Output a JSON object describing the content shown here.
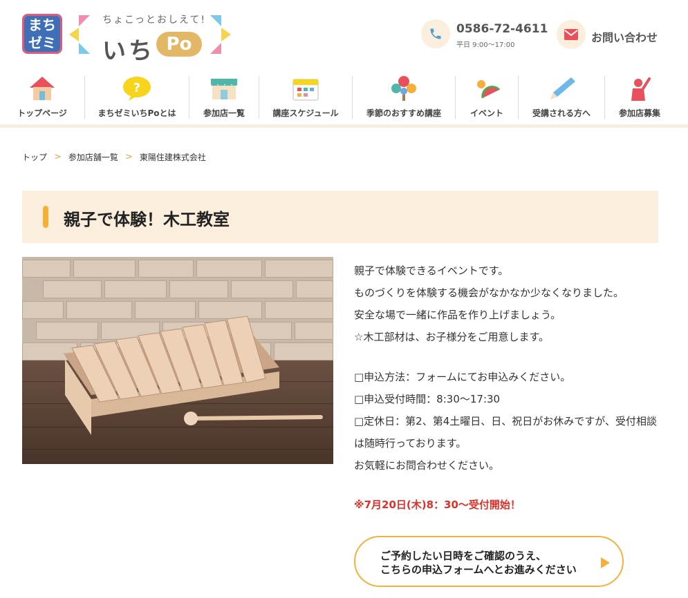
{
  "header": {
    "logo_machizemi": [
      "まち",
      "ゼミ"
    ],
    "logo_tagline": "ちょこっとおしえて!",
    "logo_ichi": "いち",
    "logo_po": "Po",
    "phone": {
      "number": "0586-72-4611",
      "hours": "平日 9:00〜17:00",
      "icon": "phone-icon"
    },
    "mail": {
      "label": "お問い合わせ",
      "icon": "mail-icon"
    }
  },
  "nav": {
    "items": [
      {
        "label": "トップページ",
        "icon": "house-icon"
      },
      {
        "label": "まちゼミいちPoとは",
        "icon": "question-bubble-icon"
      },
      {
        "label": "参加店一覧",
        "icon": "shop-icon"
      },
      {
        "label": "講座スケジュール",
        "icon": "calendar-icon"
      },
      {
        "label": "季節のおすすめ講座",
        "icon": "tree-icon"
      },
      {
        "label": "イベント",
        "icon": "watermelon-icon"
      },
      {
        "label": "受講される方へ",
        "icon": "pencil-icon"
      },
      {
        "label": "参加店募集",
        "icon": "person-raising-hand-icon"
      }
    ]
  },
  "breadcrumb": {
    "items": [
      "トップ",
      "参加店舗一覧",
      "東陽住建株式会社"
    ],
    "separator": ">"
  },
  "page": {
    "title": "親子で体験！木工教室",
    "description": [
      "親子で体験できるイベントです。",
      "ものづくりを体験する機会がなかなか少なくなりました。",
      "安全な場で一緒に作品を作り上げましょう。",
      "☆木工部材は、お子様分をご用意します。"
    ],
    "details": [
      "□申込方法：フォームにてお申込みください。",
      "□申込受付時間：8:30〜17:30",
      "□定休日：第2、第4土曜日、日、祝日がお休みですが、受付相談は随時行っております。",
      "お気軽にお問合わせください。"
    ],
    "notice": "※7月20日(木)8：30〜受付開始！",
    "cta_line1": "ご予約したい日時をご確認のうえ、",
    "cta_line2": "こちらの申込フォームへとお進みください"
  },
  "colors": {
    "accent": "#f5b03a",
    "title_bg": "#fbeedd",
    "notice": "#e0302a",
    "logo_blue": "#3f6fb6",
    "logo_pink": "#e05a7a"
  }
}
